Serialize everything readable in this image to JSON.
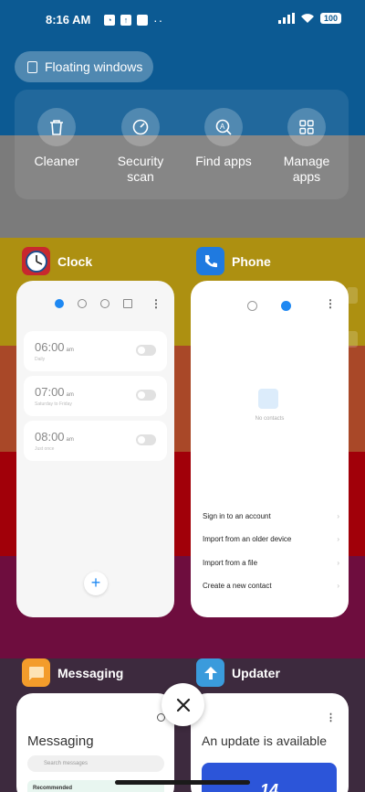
{
  "status_bar": {
    "time": "8:16 AM",
    "battery": "100"
  },
  "floating_windows": {
    "label": "Floating windows"
  },
  "quick_actions": [
    {
      "label": "Cleaner",
      "icon": "trash-icon"
    },
    {
      "label": "Security scan",
      "icon": "security-icon"
    },
    {
      "label": "Find apps",
      "icon": "find-apps-icon"
    },
    {
      "label": "Manage apps",
      "icon": "grid-icon"
    }
  ],
  "apps": {
    "clock": {
      "name": "Clock",
      "alarms": [
        {
          "time": "06:00",
          "ampm": "am",
          "sub": "Daily"
        },
        {
          "time": "07:00",
          "ampm": "am",
          "sub": "Saturday to Friday"
        },
        {
          "time": "08:00",
          "ampm": "am",
          "sub": "Just once"
        }
      ],
      "add_label": "+"
    },
    "phone": {
      "name": "Phone",
      "empty_text": "No contacts",
      "options": [
        "Sign in to an account",
        "Import from an older device",
        "Import from a file",
        "Create a new contact"
      ]
    },
    "messaging": {
      "name": "Messaging",
      "title": "Messaging",
      "search_placeholder": "Search messages",
      "recommended": "Recommended"
    },
    "updater": {
      "name": "Updater",
      "title": "An update is available",
      "banner": "14"
    }
  },
  "colors": {
    "accent": "#1e88f2",
    "clock_icon_bg": "#c8282e",
    "phone_icon_bg": "#1f7ae0",
    "messaging_icon_bg": "#f39c2b",
    "updater_icon_bg": "#3a9bdc"
  }
}
